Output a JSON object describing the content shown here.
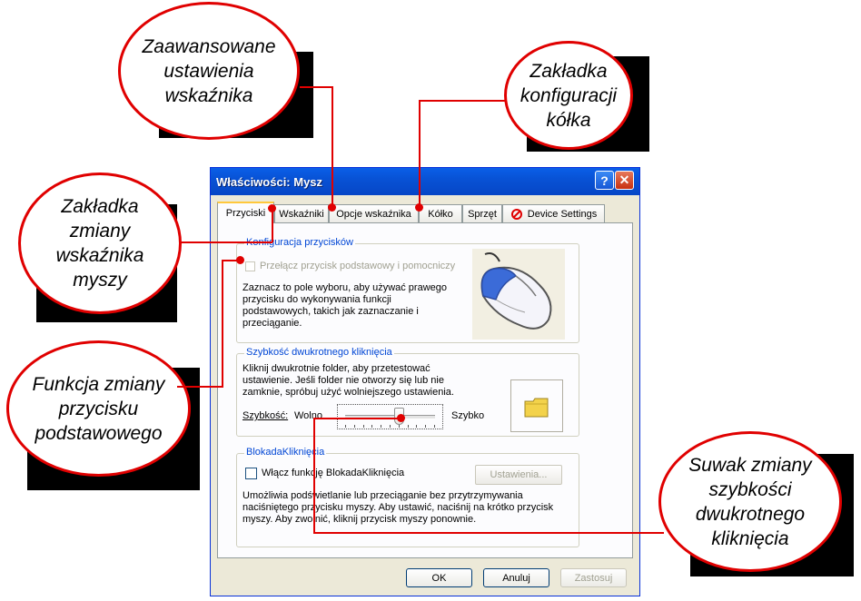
{
  "window": {
    "title": "Właściwości: Mysz",
    "help_label": "?",
    "close_label": "✕"
  },
  "tabs": [
    {
      "label": "Przyciski",
      "active": true
    },
    {
      "label": "Wskaźniki"
    },
    {
      "label": "Opcje wskaźnika"
    },
    {
      "label": "Kółko"
    },
    {
      "label": "Sprzęt"
    },
    {
      "label": "Device Settings"
    }
  ],
  "buttons_group": {
    "title": "Konfiguracja przycisków",
    "checkbox_label": "Przełącz przycisk podstawowy i pomocniczy",
    "description": "Zaznacz to pole wyboru, aby używać prawego\nprzycisku do wykonywania funkcji\npodstawowych, takich jak zaznaczanie i\nprzeciąganie."
  },
  "double_click_group": {
    "title": "Szybkość dwukrotnego kliknięcia",
    "description": "Kliknij dwukrotnie folder, aby przetestować\nustawienie. Jeśli folder nie otworzy się lub nie\nzamknie, spróbuj użyć wolniejszego ustawienia.",
    "speed_label": "Szybkość:",
    "slow_label": "Wolno",
    "fast_label": "Szybko",
    "slider_value": 0.6
  },
  "clicklock_group": {
    "title": "BlokadaKliknięcia",
    "checkbox_label": "Włącz funkcję BlokadaKliknięcia",
    "settings_button": "Ustawienia...",
    "description": "Umożliwia podświetlanie lub przeciąganie bez przytrzymywania\nnaciśniętego przycisku myszy. Aby ustawić, naciśnij na krótko przycisk\nmyszy. Aby zwolnić, kliknij przycisk myszy ponownie."
  },
  "footer": {
    "ok": "OK",
    "cancel": "Anuluj",
    "apply": "Zastosuj"
  },
  "callouts": {
    "pointer_options": "Zaawansowane\nustawienia\nwskaźnika",
    "wheel": "Zakładka\nkonfiguracji\nkółka",
    "pointers": "Zakładka\nzmiany\nwskaźnika\nmyszy",
    "button_switch": "Funkcja zmiany\nprzycisku\npodstawowego",
    "slider": "Suwak zmiany\nszybkości\ndwukrotnego\nkliknięcia"
  },
  "colors": {
    "callout_border": "#e00000",
    "titlebar": "#0852d5",
    "group_title": "#0046d5"
  }
}
